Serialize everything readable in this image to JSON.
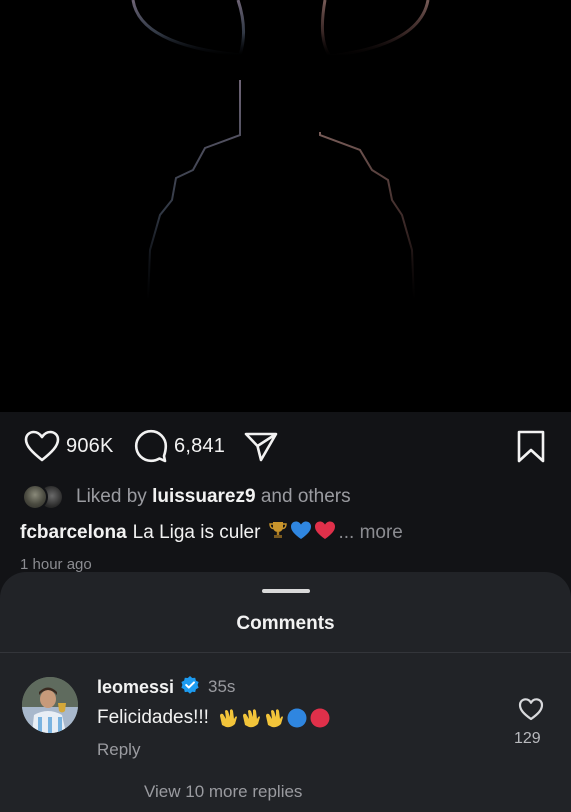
{
  "post": {
    "image": {
      "description_icon": "trophy-silhouette-icon"
    },
    "likes_count": "906K",
    "comments_count": "6,841",
    "liked_by": {
      "prefix": "Liked by",
      "user": "luissuarez9",
      "suffix": "and others"
    },
    "caption": {
      "user": "fcbarcelona",
      "text": "La Liga is culer",
      "emojis": [
        "trophy",
        "blue-heart",
        "red-heart"
      ],
      "more": "... more"
    },
    "time_ago": "1 hour ago"
  },
  "comments_sheet": {
    "title": "Comments",
    "comment": {
      "username": "leomessi",
      "verified": true,
      "time": "35s",
      "text": "Felicidades!!!",
      "emojis": [
        "clapping-hands",
        "clapping-hands",
        "clapping-hands",
        "blue-circle",
        "red-circle"
      ],
      "reply_label": "Reply",
      "like_count": "129"
    },
    "view_more_label": "View 10 more replies"
  },
  "colors": {
    "accent_verified": "#1d9bf0",
    "sheet_bg": "#212327",
    "meta_bg": "#121316"
  }
}
